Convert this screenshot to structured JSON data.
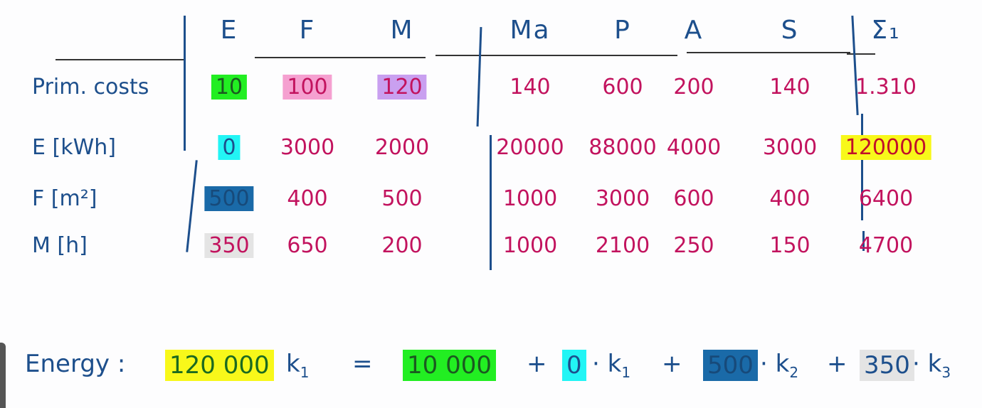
{
  "header": {
    "columns": [
      "E",
      "F",
      "M",
      "Ma",
      "P",
      "A",
      "S",
      "Σ₁"
    ]
  },
  "rows": [
    {
      "label": "Prim. costs",
      "values": [
        "10",
        "100",
        "120",
        "140",
        "600",
        "200",
        "140",
        "1.310"
      ]
    },
    {
      "label": "E [kWh]",
      "values": [
        "0",
        "3000",
        "2000",
        "20000",
        "88000",
        "4000",
        "3000",
        "120000"
      ]
    },
    {
      "label": "F [m²]",
      "values": [
        "500",
        "400",
        "500",
        "1000",
        "3000",
        "600",
        "400",
        "6400"
      ]
    },
    {
      "label": "M [h]",
      "values": [
        "350",
        "650",
        "200",
        "1000",
        "2100",
        "250",
        "150",
        "4700"
      ]
    }
  ],
  "equation": {
    "label": "Energy :",
    "lhs": "120 000",
    "k1": "k",
    "sub1": "1",
    "equals": "=",
    "t1": "10 000",
    "plus": "+",
    "t2": "0",
    "dot": "·",
    "t3": "500",
    "sub2": "2",
    "t4": "350",
    "sub3": "3"
  },
  "colors": {
    "ink_blue": "#1d4f8c",
    "ink_magenta": "#c2135e",
    "highlight_green": "#22ee22",
    "highlight_pink": "#f5a0d0",
    "highlight_purple": "#c9a0f0",
    "highlight_yellow": "#f8f81a",
    "highlight_cyan": "#22f5f5",
    "highlight_darkblue": "#1a6aa8",
    "highlight_gray": "#e4e4e4"
  }
}
